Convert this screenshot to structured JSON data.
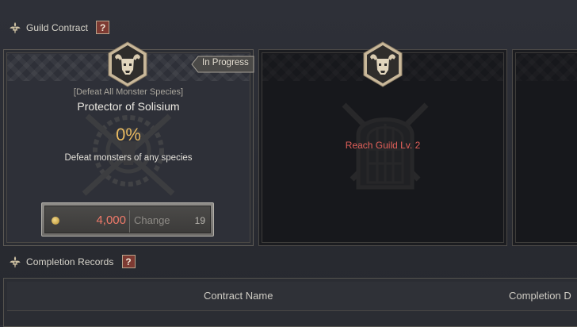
{
  "guild_contract": {
    "title": "Guild Contract",
    "help_label": "?"
  },
  "contracts": [
    {
      "status": "In Progress",
      "subtitle": "[Defeat All Monster Species]",
      "title": "Protector of Solisium",
      "progress": "0%",
      "description": "Defeat monsters of any species",
      "change_button": {
        "cost": "4,000",
        "label": "Change",
        "remaining": "19"
      }
    },
    {
      "requirement": "Reach Guild Lv. 2"
    }
  ],
  "completion_records": {
    "title": "Completion Records",
    "help_label": "?",
    "columns": [
      "Contract Name",
      "Completion D"
    ]
  },
  "colors": {
    "accent_gold": "#e7b860",
    "warning_red": "#e2605a",
    "cost_red": "#f07a6a",
    "help_red": "#7d3a32"
  },
  "icons": {
    "section": "fleur-de-lis-icon",
    "crest": "horned-skull-crest-icon",
    "currency": "gold-coin-icon",
    "watermark_active": "crossed-swords-wheel-emblem",
    "watermark_locked": "gate-crossed-swords-emblem"
  }
}
